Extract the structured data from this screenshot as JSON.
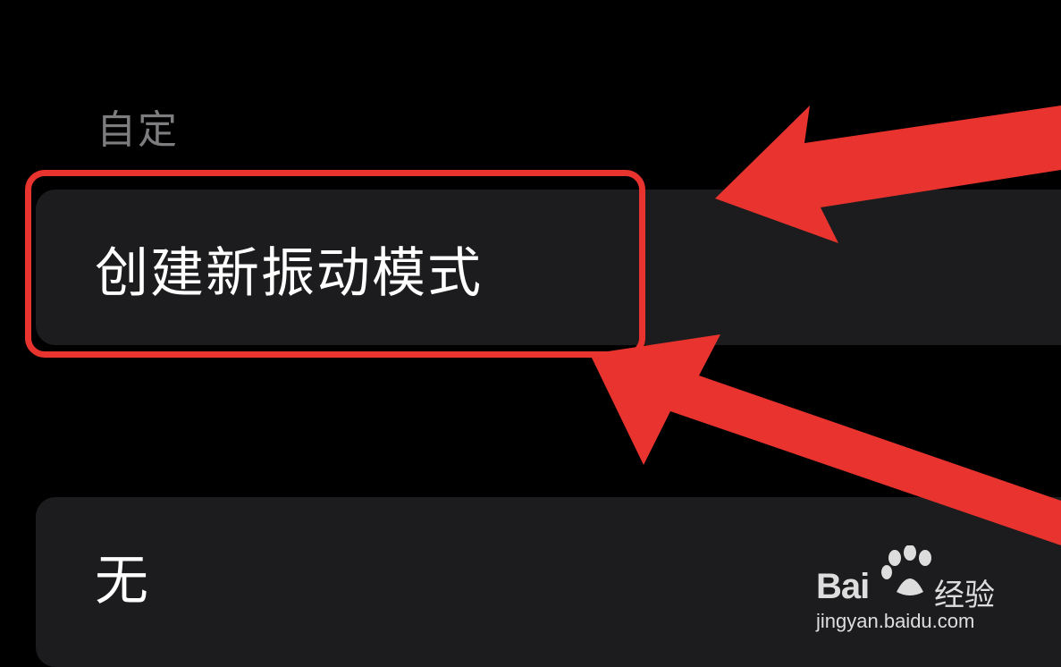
{
  "section": {
    "header": "自定"
  },
  "rows": [
    {
      "label": "创建新振动模式"
    },
    {
      "label": "无"
    }
  ],
  "annotation": {
    "color": "#e8332e"
  },
  "watermark": {
    "brand": "Bai",
    "brand_cn": "经验",
    "url": "jingyan.baidu.com",
    "icon": "baidu-paw-icon"
  }
}
